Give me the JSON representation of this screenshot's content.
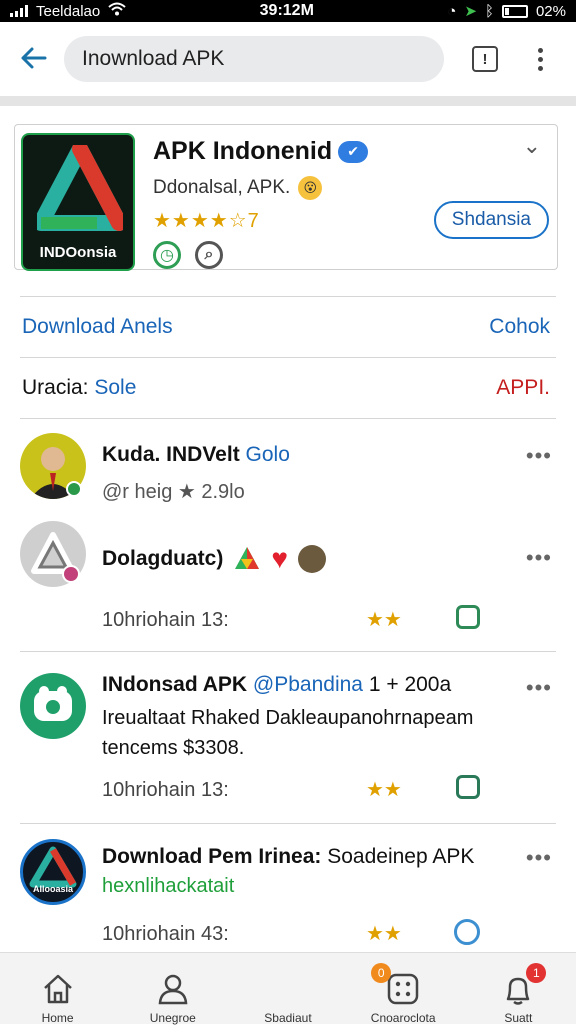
{
  "status_bar": {
    "carrier": "Teeldalao",
    "time": "39:12M",
    "battery": "02%"
  },
  "search": {
    "value": "Inownload APK"
  },
  "app": {
    "title": "APK Indonenid",
    "subtitle": "Ddonalsal, APK.",
    "rating_stars": "★★★★☆7",
    "logo_text": "INDOonsia",
    "open_button": "Shdansia"
  },
  "links": {
    "left": "Download Anels",
    "right": "Cohok"
  },
  "categories": {
    "label": "Uracia:",
    "value": "Sole",
    "right": "APPI."
  },
  "feed": [
    {
      "name": "Kuda. INDVelt",
      "handle": "Golo",
      "meta": "@r heig ★ 2.9lo"
    },
    {
      "name": "Dolagduatc)",
      "meta": "10hriohain 13:",
      "stars": "★★"
    },
    {
      "name": "INdonsad APK",
      "handle": "@Pbandina",
      "extra": "1 + 200a",
      "line2": "Ireualtaat Rhaked Dakleaupanohrnapeam",
      "line3": "tencems $3308.",
      "meta": "10hriohain 13:",
      "stars": "★★"
    },
    {
      "name": "Download Pem Irinea:",
      "extra": "Soadeinep APK",
      "line2": "hexnlihackatait",
      "logo_text": "AIlooasia",
      "meta": "10hriohain 43:",
      "stars": "★★"
    }
  ],
  "bottom_nav": [
    {
      "label": "Home",
      "badge": ""
    },
    {
      "label": "Unegroe",
      "badge": ""
    },
    {
      "label": "Sbadiaut",
      "badge": ""
    },
    {
      "label": "Cnoaroclota",
      "badge": "0"
    },
    {
      "label": "Suatt",
      "badge": "1"
    }
  ],
  "colors": {
    "accent": "#1a65b8",
    "star": "#e0a100",
    "red": "#c41e1e",
    "green": "#1f9f4a"
  }
}
